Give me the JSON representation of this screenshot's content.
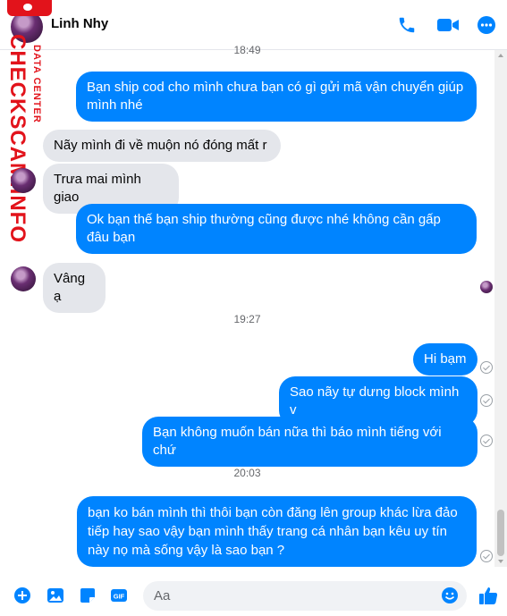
{
  "header": {
    "contact_name": "Linh Nhy"
  },
  "watermark": {
    "brand": "CHECKSCAM.INFO",
    "tagline": "DATA CENTER"
  },
  "messages": [
    {
      "time": "18:49"
    },
    {
      "from": "me",
      "text": "Bạn ship cod cho mình chưa bạn có gì gửi mã vận chuyển giúp mình nhé"
    },
    {
      "from": "them",
      "text": "Nãy mình đi về muộn nó đóng mất r"
    },
    {
      "from": "them",
      "text": "Trưa mai mình giao"
    },
    {
      "from": "me",
      "text": "Ok bạn thế bạn ship thường cũng được nhé không cần gấp đâu bạn"
    },
    {
      "from": "them",
      "text": "Vâng ạ"
    },
    {
      "time": "19:27"
    },
    {
      "from": "me",
      "text": "Hi bạm"
    },
    {
      "from": "me",
      "text": "Sao nãy tự dưng block mình v"
    },
    {
      "from": "me",
      "text": "Bạn không muốn bán nữa thì báo mình tiếng với chứ"
    },
    {
      "time": "20:03"
    },
    {
      "from": "me",
      "text": "bạn ko bán mình thì thôi bạn còn đăng lên group khác lừa đảo tiếp hay sao vậy bạn mình thấy trang cá nhân bạn kêu uy tín này nọ mà sống vậy là sao bạn ?"
    }
  ],
  "composer": {
    "placeholder": "Aa"
  },
  "colors": {
    "accent": "#0084ff",
    "incoming": "#e4e6eb",
    "watermark": "#e2131b"
  },
  "icons": [
    "phone-icon",
    "video-camera-icon",
    "more-options-icon",
    "plus-circle-icon",
    "image-icon",
    "sticker-icon",
    "gif-icon",
    "emoji-icon",
    "thumbs-up-icon"
  ]
}
